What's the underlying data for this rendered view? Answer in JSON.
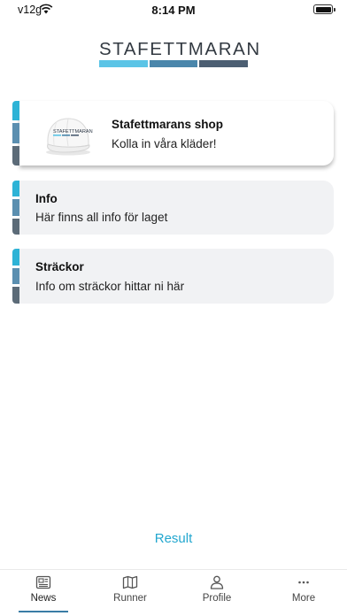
{
  "status_bar": {
    "carrier": "v12g",
    "time": "8:14 PM"
  },
  "logo": {
    "text": "STAFETTMARAN",
    "bar_colors": [
      "#5bc4e6",
      "#4a86ab",
      "#4c5e72"
    ]
  },
  "cards": [
    {
      "title": "Stafettmarans shop",
      "subtitle": "Kolla in våra kläder!",
      "image": "white-cap-icon",
      "cap_text": "STAFETTMARAN"
    },
    {
      "title": "Info",
      "subtitle": "Här finns all info för laget"
    },
    {
      "title": "Sträckor",
      "subtitle": "Info om sträckor hittar ni här"
    }
  ],
  "accent_colors": [
    "#2eb3d6",
    "#5b8fb0",
    "#5c6b78"
  ],
  "result_label": "Result",
  "result_color": "#23a7cf",
  "tabs": [
    {
      "label": "News",
      "icon": "newspaper-icon",
      "active": true
    },
    {
      "label": "Runner",
      "icon": "map-icon",
      "active": false
    },
    {
      "label": "Profile",
      "icon": "person-icon",
      "active": false
    },
    {
      "label": "More",
      "icon": "ellipsis-icon",
      "active": false
    }
  ]
}
